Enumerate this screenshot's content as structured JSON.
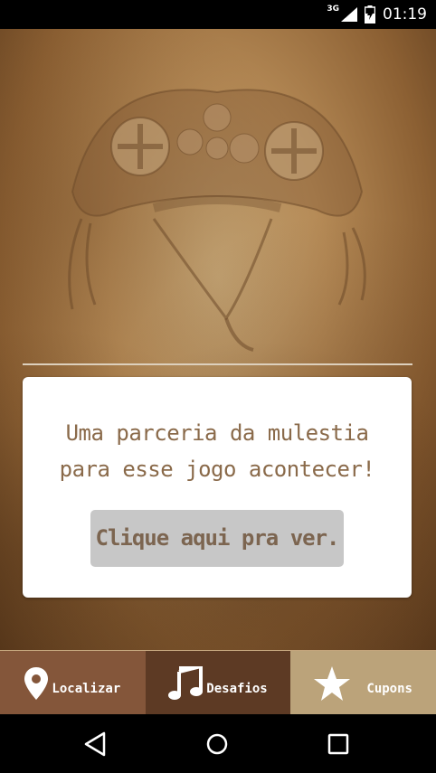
{
  "status_bar": {
    "network": "3G",
    "time": "01:19",
    "icons": [
      "signal-icon",
      "battery-icon"
    ]
  },
  "card": {
    "message_line1": "Uma parceria da mulestia",
    "message_line2": "para esse jogo acontecer!",
    "button_label": "Clique aqui pra ver."
  },
  "tabs": [
    {
      "label": "Localizar",
      "icon": "location-pin-icon"
    },
    {
      "label": "Desafios",
      "icon": "music-note-icon"
    },
    {
      "label": "Cupons",
      "icon": "star-icon"
    }
  ],
  "nav": {
    "icons": [
      "back-icon",
      "home-icon",
      "recents-icon"
    ]
  },
  "colors": {
    "tab_localizar": "#84563a",
    "tab_desafios": "#5d3a24",
    "tab_cupons_active": "#bba37a",
    "card_text": "#8a6a4a",
    "button_bg": "#c7c7c7"
  }
}
